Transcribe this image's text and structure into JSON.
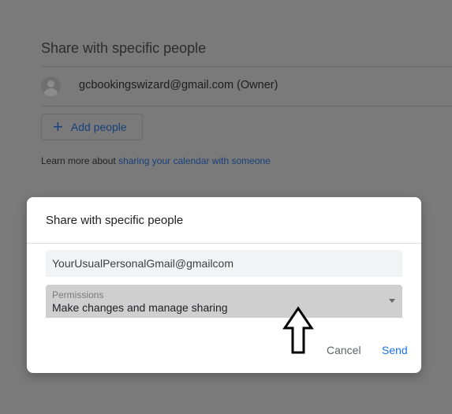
{
  "background": {
    "section_title": "Share with specific people",
    "owner_email": "gcbookingswizard@gmail.com (Owner)",
    "add_people_label": "Add people",
    "learn_more_prefix": "Learn more about",
    "learn_more_link": "sharing your calendar with someone"
  },
  "dialog": {
    "title": "Share with specific people",
    "email_value": "YourUsualPersonalGmail@gmailcom",
    "permissions_label": "Permissions",
    "permissions_value": "Make changes and manage sharing",
    "cancel_label": "Cancel",
    "send_label": "Send"
  },
  "icons": {
    "avatar": "person-avatar-icon",
    "add": "plus-icon",
    "dropdown": "caret-down-icon",
    "annotation": "up-arrow-icon"
  },
  "colors": {
    "accent": "#1a73e8",
    "overlay": "#7a7a7a",
    "dialog_bg": "#ffffff"
  }
}
